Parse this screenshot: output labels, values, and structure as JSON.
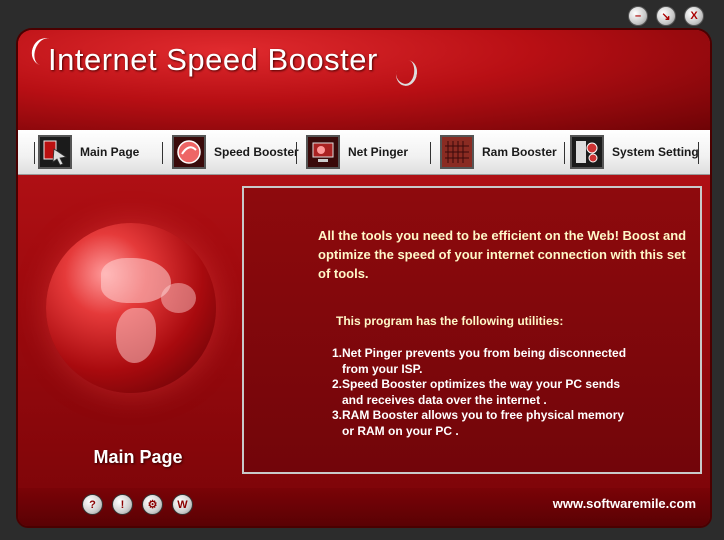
{
  "app": {
    "title": "Internet Speed Booster"
  },
  "window_controls": {
    "minimize": "–",
    "restore": "↘",
    "close": "X"
  },
  "toolbar": {
    "tabs": [
      {
        "label": "Main Page",
        "icon": "main-page-icon"
      },
      {
        "label": "Speed Booster",
        "icon": "speed-booster-icon"
      },
      {
        "label": "Net Pinger",
        "icon": "net-pinger-icon"
      },
      {
        "label": "Ram Booster",
        "icon": "ram-booster-icon"
      },
      {
        "label": "System Setting",
        "icon": "system-setting-icon"
      }
    ]
  },
  "left_panel": {
    "title": "Main Page"
  },
  "content": {
    "intro": "All the tools you need to be efficient on the Web! Boost and optimize the speed of your internet connection with this set of tools.",
    "utilities_heading": "This program has the following utilities:",
    "utilities": [
      "1.Net Pinger prevents you from being disconnected",
      "   from your ISP.",
      "2.Speed Booster optimizes the way your PC sends",
      "   and receives data over the internet .",
      "3.RAM Booster allows you to free physical memory",
      "   or RAM on your PC ."
    ]
  },
  "footer": {
    "buttons": [
      "?",
      "!",
      "⚙",
      "W"
    ],
    "website": "www.softwaremile.com"
  },
  "colors": {
    "brand_red": "#b80f14",
    "dark_red": "#72050a",
    "text_cream": "#fff8c8"
  }
}
